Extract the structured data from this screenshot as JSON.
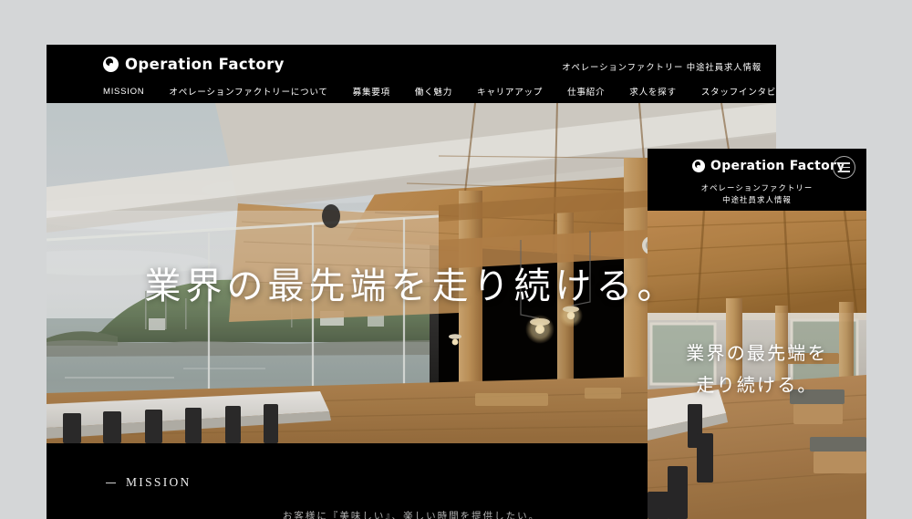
{
  "page": {
    "background_color": "#d4d6d7"
  },
  "desktop": {
    "header": {
      "logo_text": "Operation Factory",
      "logo_icon": "circular-swirl-logo-mark",
      "tagline": "オペレーションファクトリー 中途社員求人情報",
      "nav_items": [
        {
          "label": "MISSION"
        },
        {
          "label": "オペレーションファクトリーについて"
        },
        {
          "label": "募集要項"
        },
        {
          "label": "働く魅力"
        },
        {
          "label": "キャリアアップ"
        },
        {
          "label": "仕事紹介"
        },
        {
          "label": "求人を探す"
        },
        {
          "label": "スタッフインタビュー"
        }
      ]
    },
    "hero": {
      "title": "業界の最先端を走り続ける。",
      "image_alt": "restaurant-interior-wooden-beams-sea-view"
    },
    "mission": {
      "label": "MISSION",
      "dash": "–",
      "subtitle": "お客様に『美味しい』、楽しい時間を提供したい。"
    }
  },
  "mobile": {
    "header": {
      "logo_text": "Operation Factory",
      "logo_icon": "circular-swirl-logo-mark",
      "menu_icon": "hamburger-menu-icon",
      "tagline_line1": "オペレーションファクトリー",
      "tagline_line2": "中途社員求人情報"
    },
    "hero": {
      "title_line1": "業界の最先端を",
      "title_line2": "走り続ける。",
      "image_alt": "restaurant-interior-wooden-floor-tables"
    }
  },
  "colors": {
    "panel_background": "#000000",
    "page_background": "#d4d6d7",
    "text_primary": "#ffffff",
    "text_muted": "#b4b4b4"
  }
}
